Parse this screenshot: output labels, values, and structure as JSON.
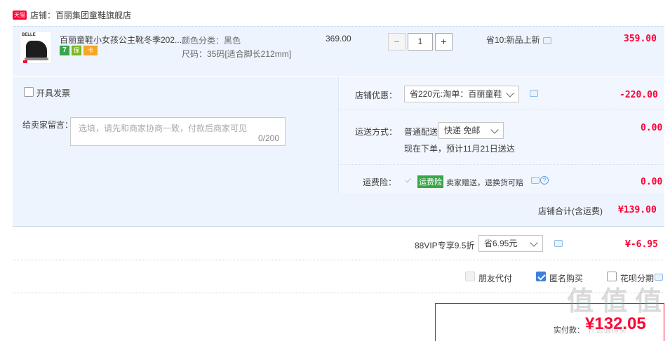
{
  "shop": {
    "badge": "天猫",
    "label": "店铺：",
    "name": "百丽集团童鞋旗舰店"
  },
  "item": {
    "brand_text": "BELLE",
    "title": "百丽童鞋小女孩公主靴冬季202...",
    "attr_color": "颜色分类：黑色",
    "attr_size": "尺码：35码[适合脚长212mm]",
    "unit_price": "369.00",
    "qty_minus": "−",
    "qty_value": "1",
    "qty_plus": "+",
    "promo": "省10:新品上新",
    "subtotal": "359.00",
    "badges": [
      "7",
      "保",
      "卡"
    ]
  },
  "invoice": {
    "label": "开具发票"
  },
  "shop_discount": {
    "label": "店铺优惠：",
    "selected": "省220元:淘单：百丽童鞋",
    "amount": "-220.00"
  },
  "message": {
    "label": "给卖家留言：",
    "placeholder": "选填，请先和商家协商一致，付款后商家可见",
    "counter": "0/200"
  },
  "shipping": {
    "label": "运送方式：",
    "method": "普通配送",
    "selected": "快递 免邮",
    "eta": "现在下单，预计11月21日送达",
    "amount": "0.00"
  },
  "insurance": {
    "label": "运费险：",
    "badge": "运费险",
    "text": "卖家赠送，退换货可赔",
    "amount": "0.00"
  },
  "shop_total": {
    "label": "店铺合计(含运费)",
    "amount": "¥139.00"
  },
  "vip": {
    "label": "88VIP专享9.5折",
    "selected": "省6.95元",
    "amount": "¥-6.95"
  },
  "options": {
    "friend_pay": "朋友代付",
    "anonymous": "匿名购买",
    "huabei": "花呗分期"
  },
  "payment": {
    "label": "实付款：",
    "amount": "¥132.05"
  },
  "watermark": {
    "text": "值 值 值",
    "site": "什么值得买"
  },
  "colors": {
    "accent_red": "#ff0036",
    "band_blue": "#eef4fe",
    "check_blue": "#3d7fe0",
    "insurance_green": "#3aa54a"
  }
}
